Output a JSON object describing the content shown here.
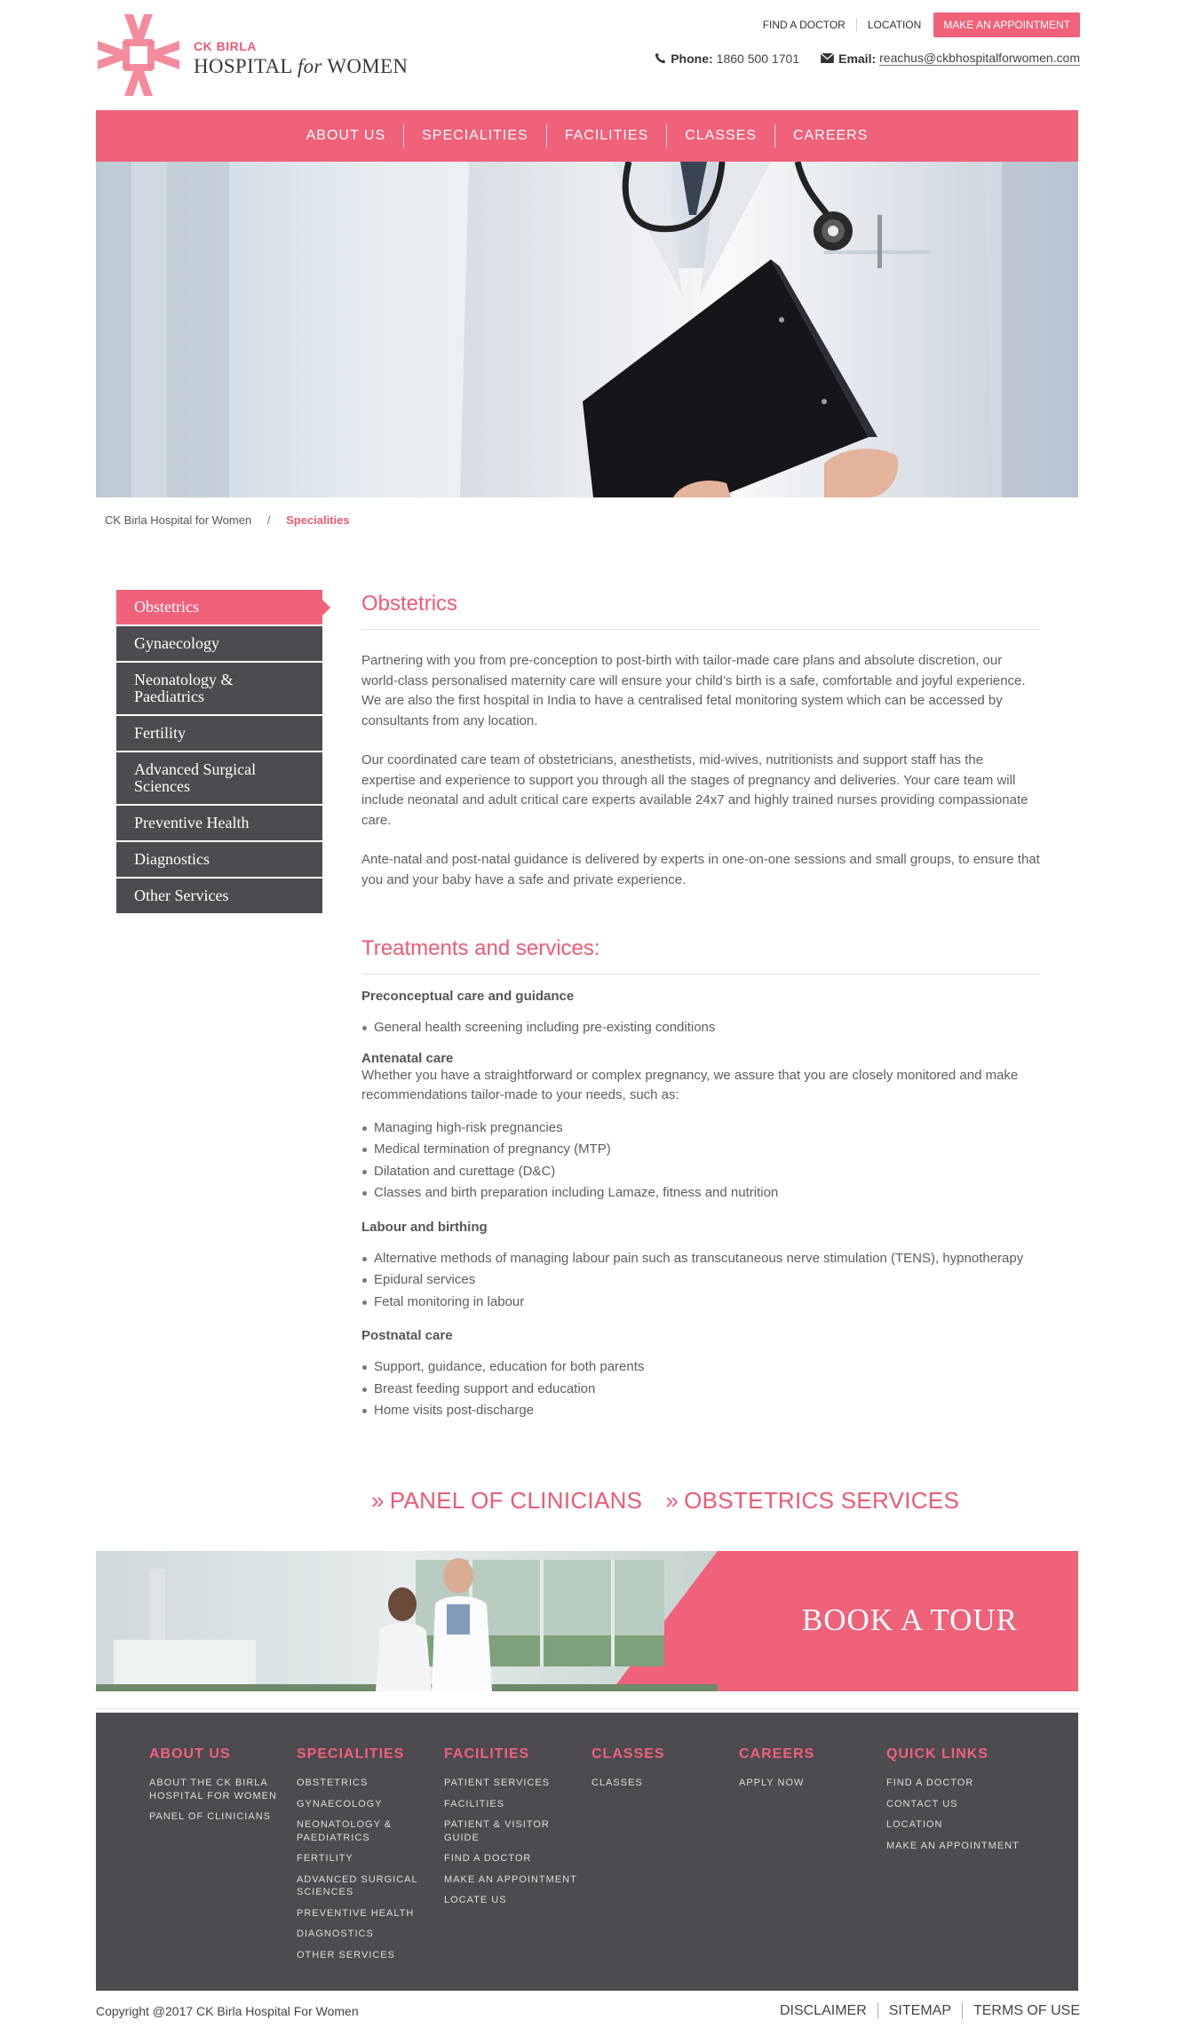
{
  "header": {
    "logo_line1": "CK BIRLA",
    "logo_line2_a": "HOSPITAL",
    "logo_line2_b": "for",
    "logo_line2_c": "WOMEN",
    "top_links": [
      "FIND A DOCTOR",
      "LOCATION"
    ],
    "appointment_button": "MAKE AN APPOINTMENT",
    "phone_label": "Phone:",
    "phone_value": "1860 500 1701",
    "email_label": "Email:",
    "email_value": "reachus@ckbhospitalforwomen.com",
    "icons": [
      "phone-icon",
      "envelope-icon"
    ]
  },
  "nav": [
    "ABOUT US",
    "SPECIALITIES",
    "FACILITIES",
    "CLASSES",
    "CAREERS"
  ],
  "breadcrumb": {
    "home": "CK Birla Hospital for Women",
    "separator": "/",
    "current": "Specialities"
  },
  "sidebar": [
    "Obstetrics",
    "Gynaecology",
    "Neonatology & Paediatrics",
    "Fertility",
    "Advanced Surgical Sciences",
    "Preventive Health",
    "Diagnostics",
    "Other Services"
  ],
  "content": {
    "title": "Obstetrics",
    "paragraphs": [
      "Partnering with you from pre-conception to post-birth with tailor-made care plans and absolute discretion, our world-class personalised maternity care will ensure your child’s birth is a safe, comfortable and joyful experience. We are also the first hospital in India to have a centralised fetal monitoring system which can be accessed by consultants from any location.",
      "Our coordinated care team of obstetricians, anesthetists, mid-wives, nutritionists and support staff has the expertise and experience to support you through all the stages of pregnancy and deliveries. Your care team will include neonatal and adult critical care experts available 24x7 and highly trained nurses providing compassionate care.",
      "Ante-natal and post-natal guidance is delivered by experts in one-on-one sessions and small groups, to ensure that you and your baby have a safe and private experience."
    ],
    "treatments_title": "Treatments and services:",
    "groups": [
      {
        "title": "Preconceptual care and guidance",
        "items": [
          "General health screening including pre-existing conditions"
        ]
      },
      {
        "title": "Antenatal care",
        "desc": "Whether you have a straightforward or complex pregnancy, we assure that you are closely monitored and make recommendations tailor-made to your needs, such as:",
        "items": [
          "Managing high-risk pregnancies",
          "Medical termination of pregnancy (MTP)",
          "Dilatation and curettage (D&C)",
          "Classes and birth preparation including Lamaze, fitness and nutrition"
        ]
      },
      {
        "title": "Labour and birthing",
        "items": [
          "Alternative methods of managing labour pain such as transcutaneous nerve stimulation (TENS), hypnotherapy",
          "Epidural services",
          "Fetal monitoring in labour"
        ]
      },
      {
        "title": "Postnatal care",
        "items": [
          "Support, guidance, education for both parents",
          "Breast feeding support and education",
          "Home visits post-discharge"
        ]
      }
    ]
  },
  "cta": {
    "chevron": "»",
    "panel": "PANEL OF CLINICIANS",
    "services": "OBSTETRICS SERVICES"
  },
  "tour": {
    "label": "BOOK A TOUR"
  },
  "footer": {
    "columns": [
      {
        "heading": "ABOUT US",
        "links": [
          "ABOUT THE CK BIRLA HOSPITAL FOR WOMEN",
          "PANEL OF CLINICIANS"
        ]
      },
      {
        "heading": "SPECIALITIES",
        "links": [
          "OBSTETRICS",
          "GYNAECOLOGY",
          "NEONATOLOGY & PAEDIATRICS",
          "FERTILITY",
          "ADVANCED SURGICAL SCIENCES",
          "PREVENTIVE HEALTH",
          "DIAGNOSTICS",
          "OTHER SERVICES"
        ]
      },
      {
        "heading": "FACILITIES",
        "links": [
          "PATIENT SERVICES",
          "FACILITIES",
          "PATIENT & VISITOR GUIDE",
          "FIND A DOCTOR",
          "MAKE AN APPOINTMENT",
          "LOCATE US"
        ]
      },
      {
        "heading": "CLASSES",
        "links": [
          "CLASSES"
        ]
      },
      {
        "heading": "CAREERS",
        "links": [
          "APPLY NOW"
        ]
      },
      {
        "heading": "QUICK LINKS",
        "links": [
          "FIND A DOCTOR",
          "CONTACT US",
          "LOCATION",
          "MAKE AN APPOINTMENT"
        ]
      }
    ],
    "copyright": "Copyright @2017 CK Birla Hospital For Women",
    "legal": [
      "DISCLAIMER",
      "SITEMAP",
      "TERMS OF USE"
    ]
  },
  "colors": {
    "accent": "#f0617a",
    "dark": "#4d4a50"
  }
}
